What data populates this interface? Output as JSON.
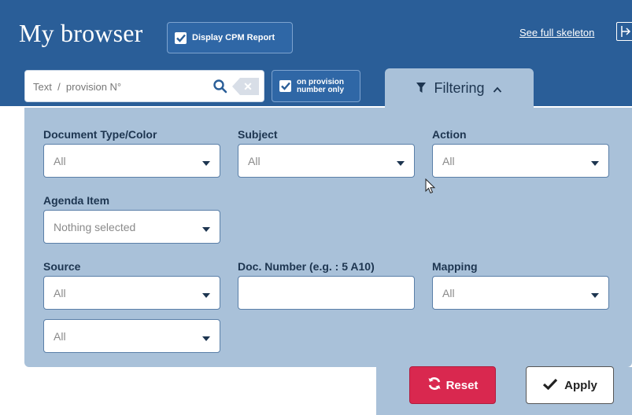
{
  "header": {
    "title": "My browser",
    "cpm_checkbox_label": "Display CPM Report",
    "skeleton_link": "See full skeleton"
  },
  "search": {
    "placeholder": "Text  /  provision N°",
    "provision_checkbox_line1": "on provision",
    "provision_checkbox_line2": "number only"
  },
  "filter_tab": {
    "label": "Filtering"
  },
  "filters": {
    "doc_type": {
      "label": "Document Type/Color",
      "value": "All"
    },
    "subject": {
      "label": "Subject",
      "value": "All"
    },
    "action": {
      "label": "Action",
      "value": "All"
    },
    "agenda": {
      "label": "Agenda Item",
      "value": "Nothing selected"
    },
    "source": {
      "label": "Source",
      "value": "All"
    },
    "doc_number": {
      "label": "Doc. Number (e.g. : 5 A10)",
      "value": ""
    },
    "mapping": {
      "label": "Mapping",
      "value": "All"
    },
    "extra": {
      "value": "All"
    }
  },
  "actions": {
    "reset": "Reset",
    "apply": "Apply"
  },
  "colors": {
    "header": "#2a5e98",
    "panel": "#a9c1d9",
    "reset": "#d9284f",
    "text_dark": "#1d3550"
  },
  "icons": [
    "checkbox-checked-icon",
    "search-icon",
    "clear-icon",
    "columns-icon",
    "filter-icon",
    "chevron-up-icon",
    "caret-down-icon",
    "refresh-icon",
    "checkmark-icon",
    "mouse-cursor-icon"
  ]
}
